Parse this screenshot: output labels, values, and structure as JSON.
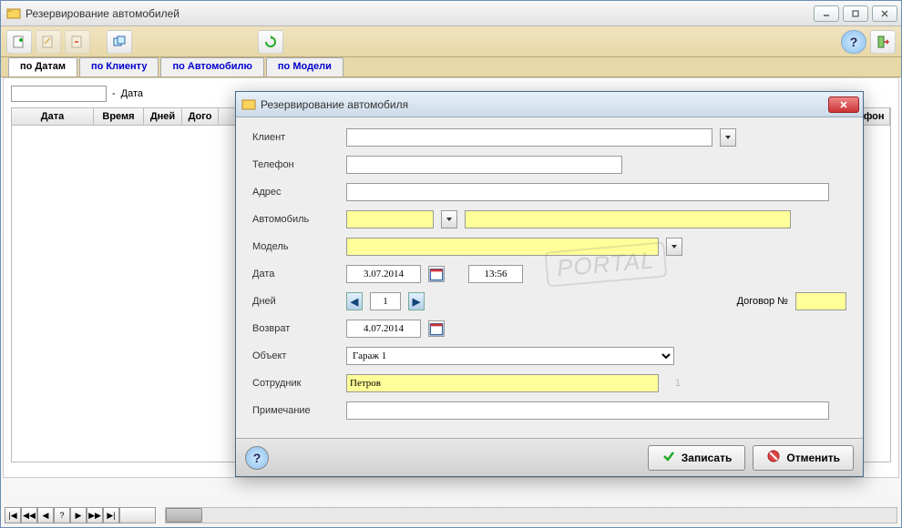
{
  "window": {
    "title": "Резервирование автомобилей"
  },
  "tabs": {
    "items": [
      {
        "label": "по Датам"
      },
      {
        "label": "по Клиенту"
      },
      {
        "label": "по Автомобилю"
      },
      {
        "label": "по Модели"
      }
    ]
  },
  "filter": {
    "separator": "-",
    "label": "Дата"
  },
  "grid": {
    "columns": [
      {
        "label": "Дата",
        "width": 90
      },
      {
        "label": "Время",
        "width": 55
      },
      {
        "label": "Дней",
        "width": 42
      },
      {
        "label": "Дого",
        "width": 40
      },
      {
        "label": "Телефон",
        "width": 70
      }
    ]
  },
  "dialog": {
    "title": "Резервирование автомобиля",
    "labels": {
      "client": "Клиент",
      "phone": "Телефон",
      "address": "Адрес",
      "car": "Автомобиль",
      "model": "Модель",
      "date": "Дата",
      "days": "Дней",
      "contract": "Договор №",
      "return": "Возврат",
      "object": "Объект",
      "employee": "Сотрудник",
      "note": "Примечание"
    },
    "values": {
      "client": "",
      "phone": "",
      "address": "",
      "car_code": "",
      "car_name": "",
      "model": "",
      "date": "3.07.2014",
      "time": "13:56",
      "days": "1",
      "contract": "",
      "return": "4.07.2014",
      "object": "Гараж 1",
      "employee": "Петров",
      "employee_id": "1",
      "note": ""
    },
    "buttons": {
      "save": "Записать",
      "cancel": "Отменить"
    }
  },
  "nav": {
    "first": "|◀",
    "prev_page": "◀◀",
    "prev": "◀",
    "status": "?",
    "next": "▶",
    "next_page": "▶▶",
    "last": "▶|"
  }
}
